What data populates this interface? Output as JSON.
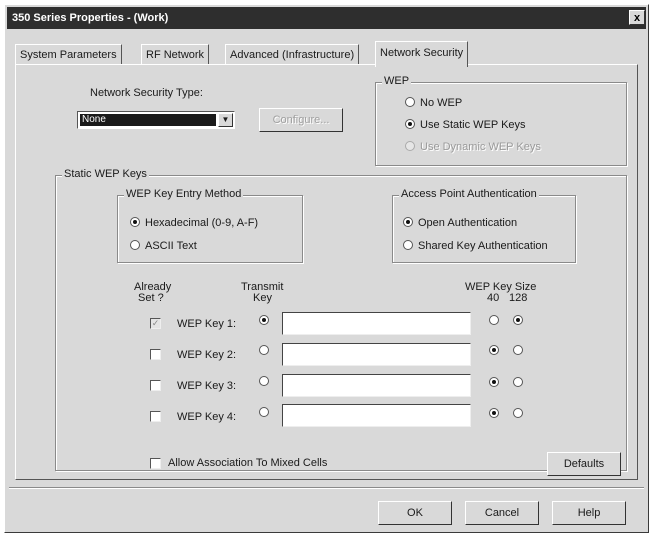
{
  "window": {
    "title": "350 Series Properties - (Work)",
    "close_glyph": "x"
  },
  "tabs": [
    "System Parameters",
    "RF Network",
    "Advanced (Infrastructure)",
    "Network Security"
  ],
  "security_type": {
    "label": "Network Security Type:",
    "value": "None",
    "configure_label": "Configure..."
  },
  "wep": {
    "title": "WEP",
    "options": [
      "No WEP",
      "Use Static WEP Keys",
      "Use Dynamic WEP Keys"
    ],
    "selected": "Use Static WEP Keys"
  },
  "static_wep": {
    "title": "Static WEP Keys",
    "entry_method": {
      "title": "WEP Key Entry Method",
      "options": [
        "Hexadecimal (0-9, A-F)",
        "ASCII Text"
      ],
      "selected": "Hexadecimal (0-9, A-F)"
    },
    "ap_auth": {
      "title": "Access Point Authentication",
      "options": [
        "Open Authentication",
        "Shared Key Authentication"
      ],
      "selected": "Open Authentication"
    },
    "headers": {
      "already_set_1": "Already",
      "already_set_2": "Set ?",
      "transmit_1": "Transmit",
      "transmit_2": "Key",
      "size": "WEP Key Size",
      "size_40": "40",
      "size_128": "128"
    },
    "keys": [
      {
        "label": "WEP Key 1:",
        "already_set": true,
        "transmit": true,
        "value": "",
        "size": "128"
      },
      {
        "label": "WEP Key 2:",
        "already_set": false,
        "transmit": false,
        "value": "",
        "size": "40"
      },
      {
        "label": "WEP Key 3:",
        "already_set": false,
        "transmit": false,
        "value": "",
        "size": "40"
      },
      {
        "label": "WEP Key 4:",
        "already_set": false,
        "transmit": false,
        "value": "",
        "size": "40"
      }
    ],
    "mixed_cells_label": "Allow Association To Mixed Cells",
    "defaults_label": "Defaults"
  },
  "footer": {
    "ok": "OK",
    "cancel": "Cancel",
    "help": "Help"
  }
}
